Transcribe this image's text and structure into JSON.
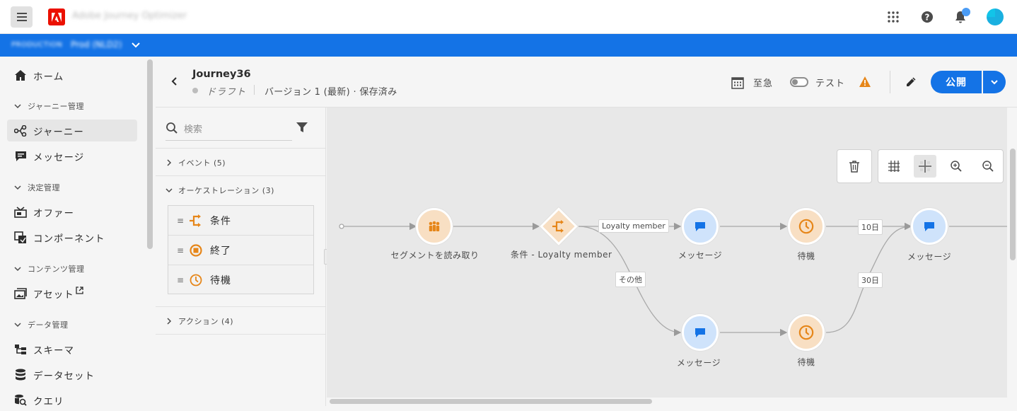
{
  "app": {
    "name": "Adobe Journey Optimizer"
  },
  "org": {
    "environment": "PRODUCTION",
    "sandbox": "Prod (NLD2)"
  },
  "topbar": {
    "icons": [
      "apps-grid-icon",
      "help-icon",
      "bell-icon",
      "user-avatar"
    ]
  },
  "nav": {
    "home": "ホーム",
    "section_journey": "ジャーニー管理",
    "journeys": "ジャーニー",
    "messages": "メッセージ",
    "section_decision": "決定管理",
    "offers": "オファー",
    "components": "コンポーネント",
    "section_content": "コンテンツ管理",
    "assets": "アセット",
    "section_data": "データ管理",
    "schemas": "スキーマ",
    "datasets": "データセット",
    "queries": "クエリ"
  },
  "journey": {
    "title": "Journey36",
    "status": "ドラフト",
    "version": "バージョン 1 (最新) · 保存済み",
    "schedule_label": "至急",
    "test_label": "テスト",
    "test_enabled": false,
    "publish_label": "公開"
  },
  "palette": {
    "search_placeholder": "検索",
    "events": "イベント (5)",
    "orchestration": "オーケストレーション (3)",
    "orchestration_items": [
      {
        "label": "条件",
        "icon": "condition-icon"
      },
      {
        "label": "終了",
        "icon": "end-icon"
      },
      {
        "label": "待機",
        "icon": "wait-icon"
      }
    ],
    "actions": "アクション (4)"
  },
  "canvas": {
    "nodes": {
      "read_segment": "セグメントを読み取り",
      "condition": "条件 - Loyalty member",
      "message_top": "メッセージ",
      "wait_top": "待機",
      "message_end": "メッセージ",
      "message_bottom": "メッセージ",
      "wait_bottom": "待機"
    },
    "edge_labels": {
      "path_loyalty": "Loyalty member",
      "path_other": "その他",
      "wait_top_duration": "10日",
      "wait_bottom_duration": "30日"
    },
    "colors": {
      "action": "#1473e6",
      "orchestration": "#e68619",
      "canvas": "#e8e8e8"
    }
  }
}
